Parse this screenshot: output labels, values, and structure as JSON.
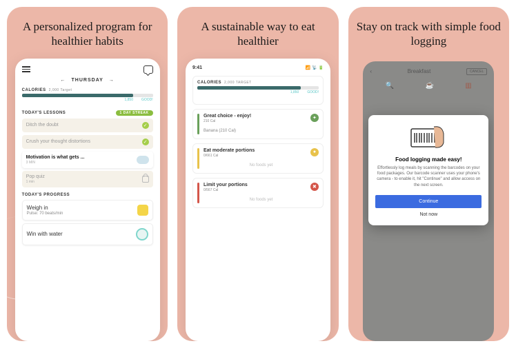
{
  "panels": {
    "p1": {
      "headline": "A personalized program for healthier habits",
      "day": "THURSDAY",
      "calories_label": "CALORIES",
      "calories_target": "2,000 Target",
      "progress_labels": {
        "current": "1,850",
        "good": "GOOD!"
      },
      "lessons_header": "TODAY'S LESSONS",
      "streak": "1 DAY STREAK",
      "lessons": [
        {
          "title": "Ditch the doubt"
        },
        {
          "title": "Crush your thought distortions"
        },
        {
          "title": "Motivation is what gets ...",
          "sub": "3 MIN"
        },
        {
          "title": "Pop quiz",
          "sub": "1 min"
        }
      ],
      "progress_header": "TODAY'S PROGRESS",
      "progress_items": [
        {
          "title": "Weigh in",
          "sub": "Pulse: 70 beats/min"
        },
        {
          "title": "Win with water"
        }
      ]
    },
    "p2": {
      "headline": "A sustainable way to eat healthier",
      "time": "9:41",
      "calories_label": "CALORIES",
      "calories_target": "2,000 TARGET",
      "progress_labels": {
        "current": "1,850",
        "good": "GOOD!"
      },
      "groups": [
        {
          "title": "Great choice - enjoy!",
          "sub": "210 Cal",
          "item": "Banana (210 Cal)",
          "color": "#6aa05a",
          "icon": "✦"
        },
        {
          "title": "Eat moderate portions",
          "sub": "0/661 Cal",
          "empty": "No foods yet",
          "color": "#e8c24b",
          "icon": "●"
        },
        {
          "title": "Limit your portions",
          "sub": "0/567 Cal",
          "empty": "No foods yet",
          "color": "#d4564a",
          "icon": "✖"
        }
      ]
    },
    "p3": {
      "headline": "Stay on track with simple food logging",
      "meal": "Breakfast",
      "cancel": "CANCEL",
      "modal": {
        "title": "Food logging made easy!",
        "body": "Effortlessly log meals by scanning the barcodes on your food packages. Our barcode scanner uses your phone's camera - to enable it, hit \"Continue\" and allow access on the next screen.",
        "continue": "Continue",
        "not_now": "Not now"
      }
    }
  }
}
